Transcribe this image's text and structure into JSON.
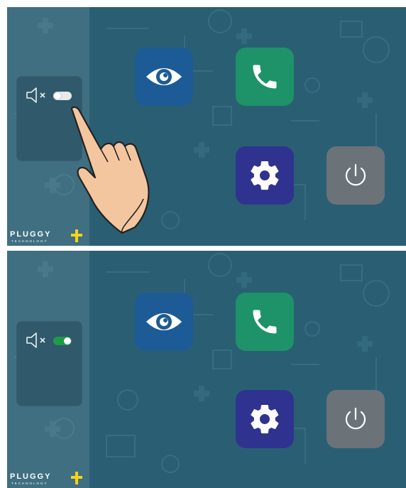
{
  "frames": [
    {
      "state": "before",
      "sound_toggle": {
        "state": "off"
      },
      "hand_visible": true
    },
    {
      "state": "after",
      "sound_toggle": {
        "state": "on"
      },
      "hand_visible": false
    }
  ],
  "tiles": [
    {
      "id": "view",
      "icon": "eye-icon",
      "color": "#1c5b95"
    },
    {
      "id": "call",
      "icon": "phone-icon",
      "color": "#1e9268"
    },
    {
      "id": "settings",
      "icon": "gear-icon",
      "color": "#2f338f"
    },
    {
      "id": "power",
      "icon": "power-icon",
      "color": "#6b7379"
    }
  ],
  "logo": {
    "wordmark": "PLUGGY",
    "sub": "TECHNOLOGY",
    "accent_color": "#f6d21c"
  },
  "colors": {
    "panel": "#2a5f73",
    "toggle_on": "#1f9a48",
    "toggle_off": "#e9e9e9"
  }
}
